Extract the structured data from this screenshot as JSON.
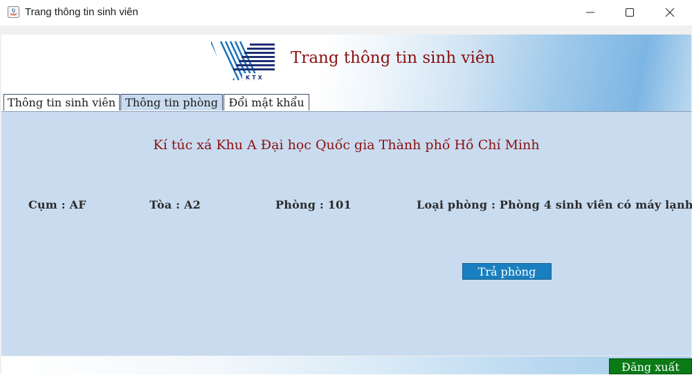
{
  "window": {
    "title": "Trang thông tin sinh viên",
    "controls": [
      "minimize-icon",
      "maximize-icon",
      "close-icon"
    ]
  },
  "header": {
    "logo_text": "KTX",
    "title": "Trang thông tin sinh viên"
  },
  "tabs": [
    {
      "label": "Thông tin sinh viên",
      "active": false
    },
    {
      "label": "Thông tin phòng",
      "active": true
    },
    {
      "label": "Đổi mật khẩu",
      "active": false
    }
  ],
  "room": {
    "dorm_name": "Kí túc xá Khu A Đại học Quốc gia Thành phố Hồ Chí Minh",
    "cluster": "Cụm : AF",
    "building": "Tòa : A2",
    "room_number": "Phòng : 101",
    "room_type": "Loại phòng : Phòng 4 sinh viên có máy lạnh",
    "return_button": "Trả phòng"
  },
  "footer": {
    "logout_button": "Đăng xuất"
  },
  "colors": {
    "title_red": "#8b1010",
    "panel_blue": "#c9dbef",
    "button_blue": "#1a7fbf",
    "logout_green": "#0a7a17"
  }
}
